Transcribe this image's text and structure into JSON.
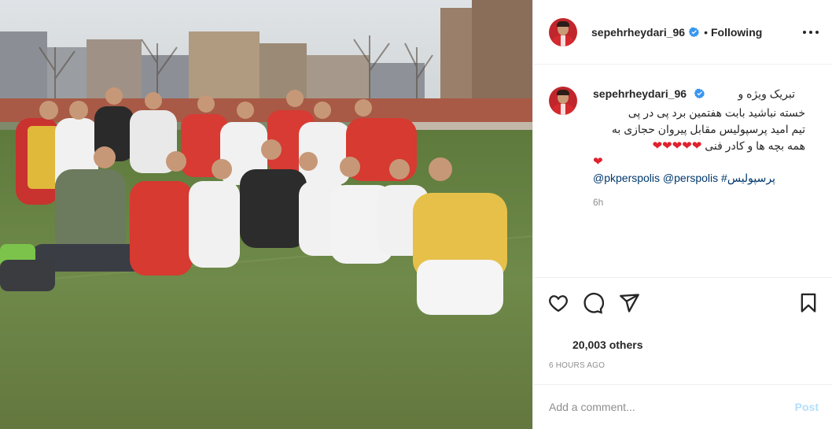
{
  "post": {
    "image_alt": "Team photo of football players in red and white kits on a pitch"
  },
  "header": {
    "username": "sepehrheydari_96",
    "separator": "•",
    "follow_status": "Following"
  },
  "caption": {
    "username": "sepehrheydari_96",
    "line1": "تبریک ویژه و",
    "line2": "خسته نباشید بابت هفتمین برد پی در پی",
    "line3": "تیم امید پرسپولیس مقابل پیروان حجازی به",
    "line4": "همه بچه ها و کادر فنی",
    "hearts_line4": "❤❤❤❤❤",
    "hearts_line5": "❤",
    "tags": "@pkperspolis @perspolis #پرسپولیس",
    "time_ago": "6h"
  },
  "engagement": {
    "likes": "20,003 others",
    "posted": "6 HOURS AGO"
  },
  "comment": {
    "placeholder": "Add a comment...",
    "post_label": "Post"
  },
  "icons": {
    "like": "heart-icon",
    "comment": "comment-icon",
    "share": "paper-plane-icon",
    "save": "bookmark-icon",
    "verified": "verified-badge-icon",
    "more": "more-options-icon"
  },
  "colors": {
    "accent_link": "#00376b",
    "verified_blue": "#3897f0",
    "heart_red": "#e0212e",
    "post_disabled": "#b2dffc"
  }
}
